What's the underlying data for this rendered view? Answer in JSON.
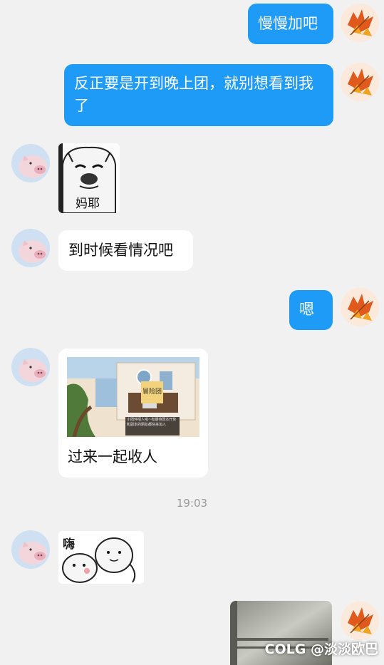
{
  "messages": {
    "m1": "慢慢加吧",
    "m2": "反正要是开到晚上团，就别想看到我了",
    "m3_sticker_caption": "妈耶",
    "m4": "到时候看情况吧",
    "m5": "嗯",
    "m6_caption": "过来一起收人",
    "m6_game_title": "冒险团",
    "m6_game_text": "小团伴招人啦~有期待团本开荒和副本的朋友都快来加入",
    "m8_sticker_text": "嗨"
  },
  "timestamp": "19:03",
  "watermark": {
    "logo": "COLG",
    "handle": "@淡淡欧巴"
  },
  "colors": {
    "bubble_me": "#1d9bf6",
    "bubble_them": "#ffffff",
    "background": "#f1f1f1"
  }
}
